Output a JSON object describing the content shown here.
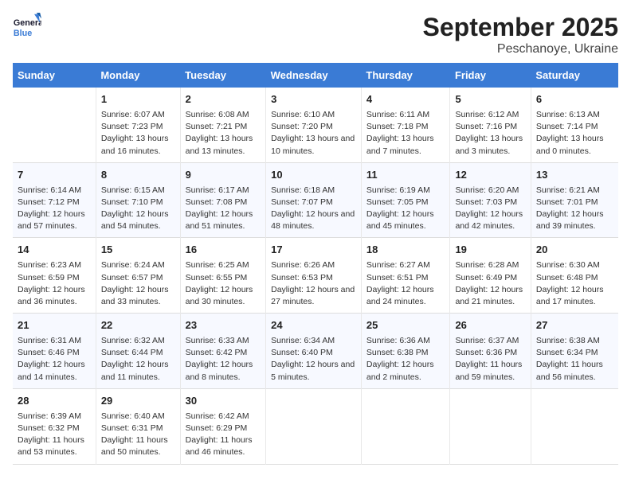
{
  "logo": {
    "line1": "General",
    "line2": "Blue"
  },
  "title": "September 2025",
  "subtitle": "Peschanoye, Ukraine",
  "headers": [
    "Sunday",
    "Monday",
    "Tuesday",
    "Wednesday",
    "Thursday",
    "Friday",
    "Saturday"
  ],
  "weeks": [
    [
      {
        "day": "",
        "sunrise": "",
        "sunset": "",
        "daylight": ""
      },
      {
        "day": "1",
        "sunrise": "Sunrise: 6:07 AM",
        "sunset": "Sunset: 7:23 PM",
        "daylight": "Daylight: 13 hours and 16 minutes."
      },
      {
        "day": "2",
        "sunrise": "Sunrise: 6:08 AM",
        "sunset": "Sunset: 7:21 PM",
        "daylight": "Daylight: 13 hours and 13 minutes."
      },
      {
        "day": "3",
        "sunrise": "Sunrise: 6:10 AM",
        "sunset": "Sunset: 7:20 PM",
        "daylight": "Daylight: 13 hours and 10 minutes."
      },
      {
        "day": "4",
        "sunrise": "Sunrise: 6:11 AM",
        "sunset": "Sunset: 7:18 PM",
        "daylight": "Daylight: 13 hours and 7 minutes."
      },
      {
        "day": "5",
        "sunrise": "Sunrise: 6:12 AM",
        "sunset": "Sunset: 7:16 PM",
        "daylight": "Daylight: 13 hours and 3 minutes."
      },
      {
        "day": "6",
        "sunrise": "Sunrise: 6:13 AM",
        "sunset": "Sunset: 7:14 PM",
        "daylight": "Daylight: 13 hours and 0 minutes."
      }
    ],
    [
      {
        "day": "7",
        "sunrise": "Sunrise: 6:14 AM",
        "sunset": "Sunset: 7:12 PM",
        "daylight": "Daylight: 12 hours and 57 minutes."
      },
      {
        "day": "8",
        "sunrise": "Sunrise: 6:15 AM",
        "sunset": "Sunset: 7:10 PM",
        "daylight": "Daylight: 12 hours and 54 minutes."
      },
      {
        "day": "9",
        "sunrise": "Sunrise: 6:17 AM",
        "sunset": "Sunset: 7:08 PM",
        "daylight": "Daylight: 12 hours and 51 minutes."
      },
      {
        "day": "10",
        "sunrise": "Sunrise: 6:18 AM",
        "sunset": "Sunset: 7:07 PM",
        "daylight": "Daylight: 12 hours and 48 minutes."
      },
      {
        "day": "11",
        "sunrise": "Sunrise: 6:19 AM",
        "sunset": "Sunset: 7:05 PM",
        "daylight": "Daylight: 12 hours and 45 minutes."
      },
      {
        "day": "12",
        "sunrise": "Sunrise: 6:20 AM",
        "sunset": "Sunset: 7:03 PM",
        "daylight": "Daylight: 12 hours and 42 minutes."
      },
      {
        "day": "13",
        "sunrise": "Sunrise: 6:21 AM",
        "sunset": "Sunset: 7:01 PM",
        "daylight": "Daylight: 12 hours and 39 minutes."
      }
    ],
    [
      {
        "day": "14",
        "sunrise": "Sunrise: 6:23 AM",
        "sunset": "Sunset: 6:59 PM",
        "daylight": "Daylight: 12 hours and 36 minutes."
      },
      {
        "day": "15",
        "sunrise": "Sunrise: 6:24 AM",
        "sunset": "Sunset: 6:57 PM",
        "daylight": "Daylight: 12 hours and 33 minutes."
      },
      {
        "day": "16",
        "sunrise": "Sunrise: 6:25 AM",
        "sunset": "Sunset: 6:55 PM",
        "daylight": "Daylight: 12 hours and 30 minutes."
      },
      {
        "day": "17",
        "sunrise": "Sunrise: 6:26 AM",
        "sunset": "Sunset: 6:53 PM",
        "daylight": "Daylight: 12 hours and 27 minutes."
      },
      {
        "day": "18",
        "sunrise": "Sunrise: 6:27 AM",
        "sunset": "Sunset: 6:51 PM",
        "daylight": "Daylight: 12 hours and 24 minutes."
      },
      {
        "day": "19",
        "sunrise": "Sunrise: 6:28 AM",
        "sunset": "Sunset: 6:49 PM",
        "daylight": "Daylight: 12 hours and 21 minutes."
      },
      {
        "day": "20",
        "sunrise": "Sunrise: 6:30 AM",
        "sunset": "Sunset: 6:48 PM",
        "daylight": "Daylight: 12 hours and 17 minutes."
      }
    ],
    [
      {
        "day": "21",
        "sunrise": "Sunrise: 6:31 AM",
        "sunset": "Sunset: 6:46 PM",
        "daylight": "Daylight: 12 hours and 14 minutes."
      },
      {
        "day": "22",
        "sunrise": "Sunrise: 6:32 AM",
        "sunset": "Sunset: 6:44 PM",
        "daylight": "Daylight: 12 hours and 11 minutes."
      },
      {
        "day": "23",
        "sunrise": "Sunrise: 6:33 AM",
        "sunset": "Sunset: 6:42 PM",
        "daylight": "Daylight: 12 hours and 8 minutes."
      },
      {
        "day": "24",
        "sunrise": "Sunrise: 6:34 AM",
        "sunset": "Sunset: 6:40 PM",
        "daylight": "Daylight: 12 hours and 5 minutes."
      },
      {
        "day": "25",
        "sunrise": "Sunrise: 6:36 AM",
        "sunset": "Sunset: 6:38 PM",
        "daylight": "Daylight: 12 hours and 2 minutes."
      },
      {
        "day": "26",
        "sunrise": "Sunrise: 6:37 AM",
        "sunset": "Sunset: 6:36 PM",
        "daylight": "Daylight: 11 hours and 59 minutes."
      },
      {
        "day": "27",
        "sunrise": "Sunrise: 6:38 AM",
        "sunset": "Sunset: 6:34 PM",
        "daylight": "Daylight: 11 hours and 56 minutes."
      }
    ],
    [
      {
        "day": "28",
        "sunrise": "Sunrise: 6:39 AM",
        "sunset": "Sunset: 6:32 PM",
        "daylight": "Daylight: 11 hours and 53 minutes."
      },
      {
        "day": "29",
        "sunrise": "Sunrise: 6:40 AM",
        "sunset": "Sunset: 6:31 PM",
        "daylight": "Daylight: 11 hours and 50 minutes."
      },
      {
        "day": "30",
        "sunrise": "Sunrise: 6:42 AM",
        "sunset": "Sunset: 6:29 PM",
        "daylight": "Daylight: 11 hours and 46 minutes."
      },
      {
        "day": "",
        "sunrise": "",
        "sunset": "",
        "daylight": ""
      },
      {
        "day": "",
        "sunrise": "",
        "sunset": "",
        "daylight": ""
      },
      {
        "day": "",
        "sunrise": "",
        "sunset": "",
        "daylight": ""
      },
      {
        "day": "",
        "sunrise": "",
        "sunset": "",
        "daylight": ""
      }
    ]
  ]
}
